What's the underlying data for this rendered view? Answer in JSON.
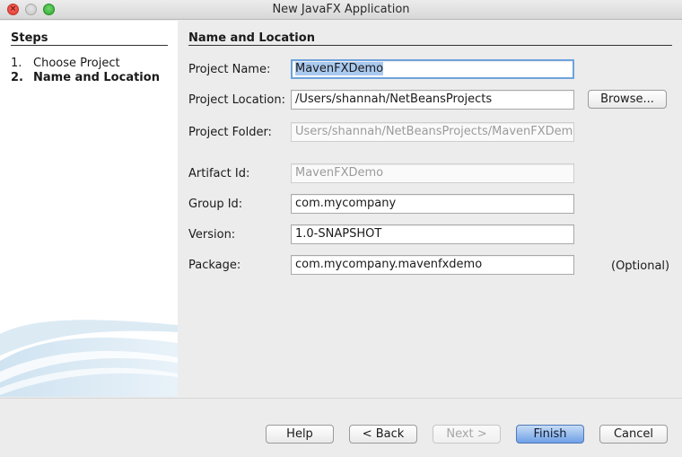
{
  "window": {
    "title": "New JavaFX Application"
  },
  "steps": {
    "heading": "Steps",
    "items": [
      {
        "num": "1.",
        "label": "Choose Project"
      },
      {
        "num": "2.",
        "label": "Name and Location"
      }
    ]
  },
  "main": {
    "heading": "Name and Location",
    "fields": {
      "project_name": {
        "label": "Project Name:",
        "value": "MavenFXDemo"
      },
      "project_location": {
        "label": "Project Location:",
        "value": "/Users/shannah/NetBeansProjects"
      },
      "project_folder": {
        "label": "Project Folder:",
        "value": "Users/shannah/NetBeansProjects/MavenFXDemo"
      },
      "artifact_id": {
        "label": "Artifact Id:",
        "value": "MavenFXDemo"
      },
      "group_id": {
        "label": "Group Id:",
        "value": "com.mycompany"
      },
      "version": {
        "label": "Version:",
        "value": "1.0-SNAPSHOT"
      },
      "package": {
        "label": "Package:",
        "value": "com.mycompany.mavenfxdemo"
      }
    },
    "browse_label": "Browse...",
    "optional_label": "(Optional)"
  },
  "buttons": {
    "help": "Help",
    "back": "< Back",
    "next": "Next >",
    "finish": "Finish",
    "cancel": "Cancel"
  },
  "colors": {
    "accent": "#6fa0e6",
    "selection": "#a9c9ef",
    "focus_ring": "#6fa3dd"
  }
}
